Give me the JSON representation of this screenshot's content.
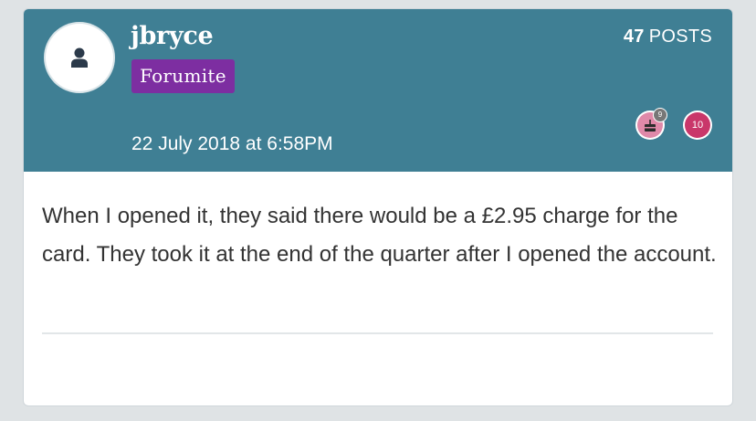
{
  "post": {
    "author": {
      "username": "jbryce",
      "role": "Forumite",
      "post_count": "47",
      "post_count_label": "POSTS",
      "avatar_icon": "user-silhouette-icon"
    },
    "timestamp": "22 July 2018 at 6:58PM",
    "achievements": [
      {
        "icon": "cake-icon",
        "color": "#e089a9",
        "count": "9"
      },
      {
        "icon": "badge-10-icon",
        "color": "#c9376a",
        "label": "10"
      }
    ],
    "body": "When I opened it, they said there would be a £2.95 charge for the card. They took it at the end of the quarter after I opened the account."
  },
  "colors": {
    "header_bg": "#3f7f94",
    "role_badge_bg": "#7d2ea1",
    "page_bg": "#dfe3e5"
  }
}
